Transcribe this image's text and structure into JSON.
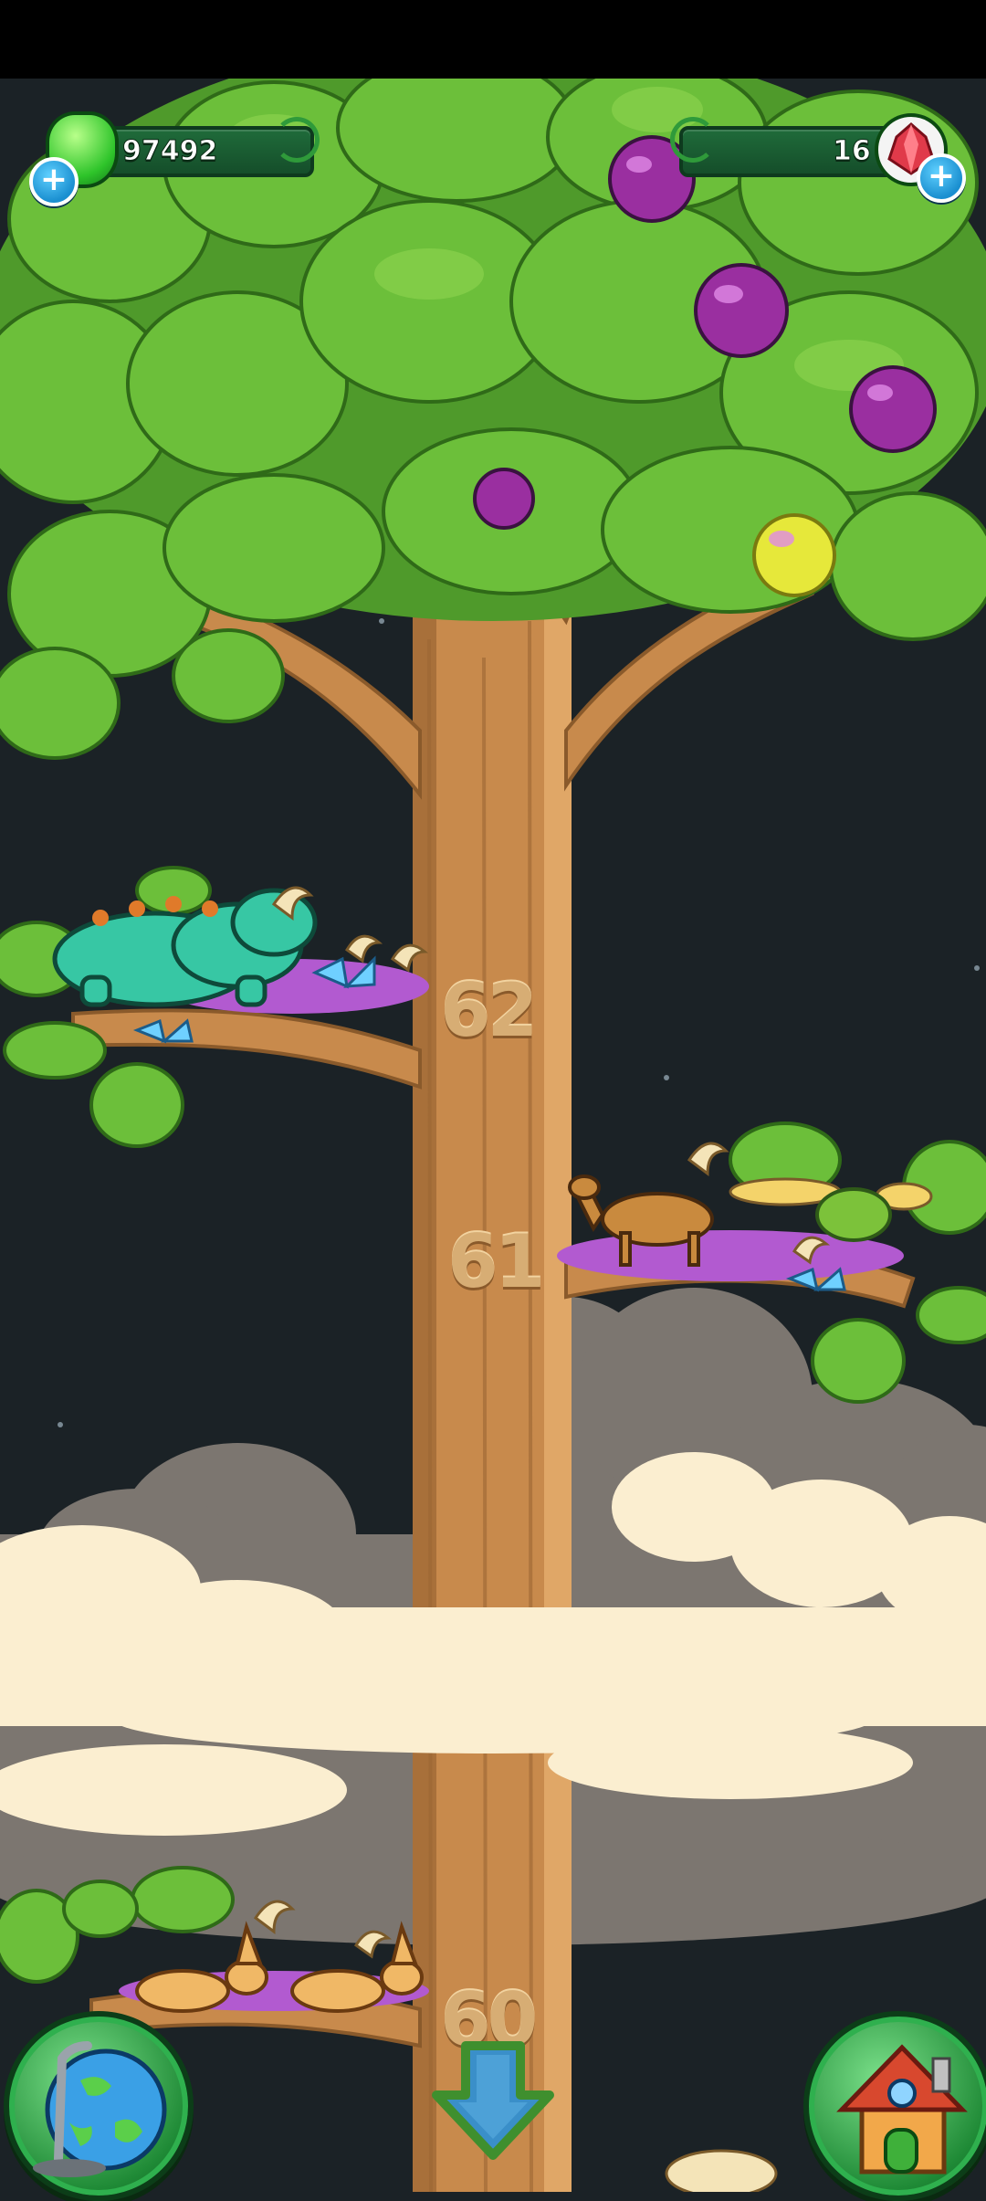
{
  "hud": {
    "slime_count": "97492",
    "gem_count": "16"
  },
  "tree_levels": [
    "62",
    "61",
    "60"
  ],
  "buttons": {
    "globe": "globe-icon",
    "home": "house-icon",
    "down": "arrow-down-icon"
  },
  "colors": {
    "background": "#1b2226",
    "trunk": "#c88a4c",
    "leaves": "#6cbf3a",
    "hud_green": "#1f6b3a",
    "plus_blue": "#1a8fd0"
  }
}
